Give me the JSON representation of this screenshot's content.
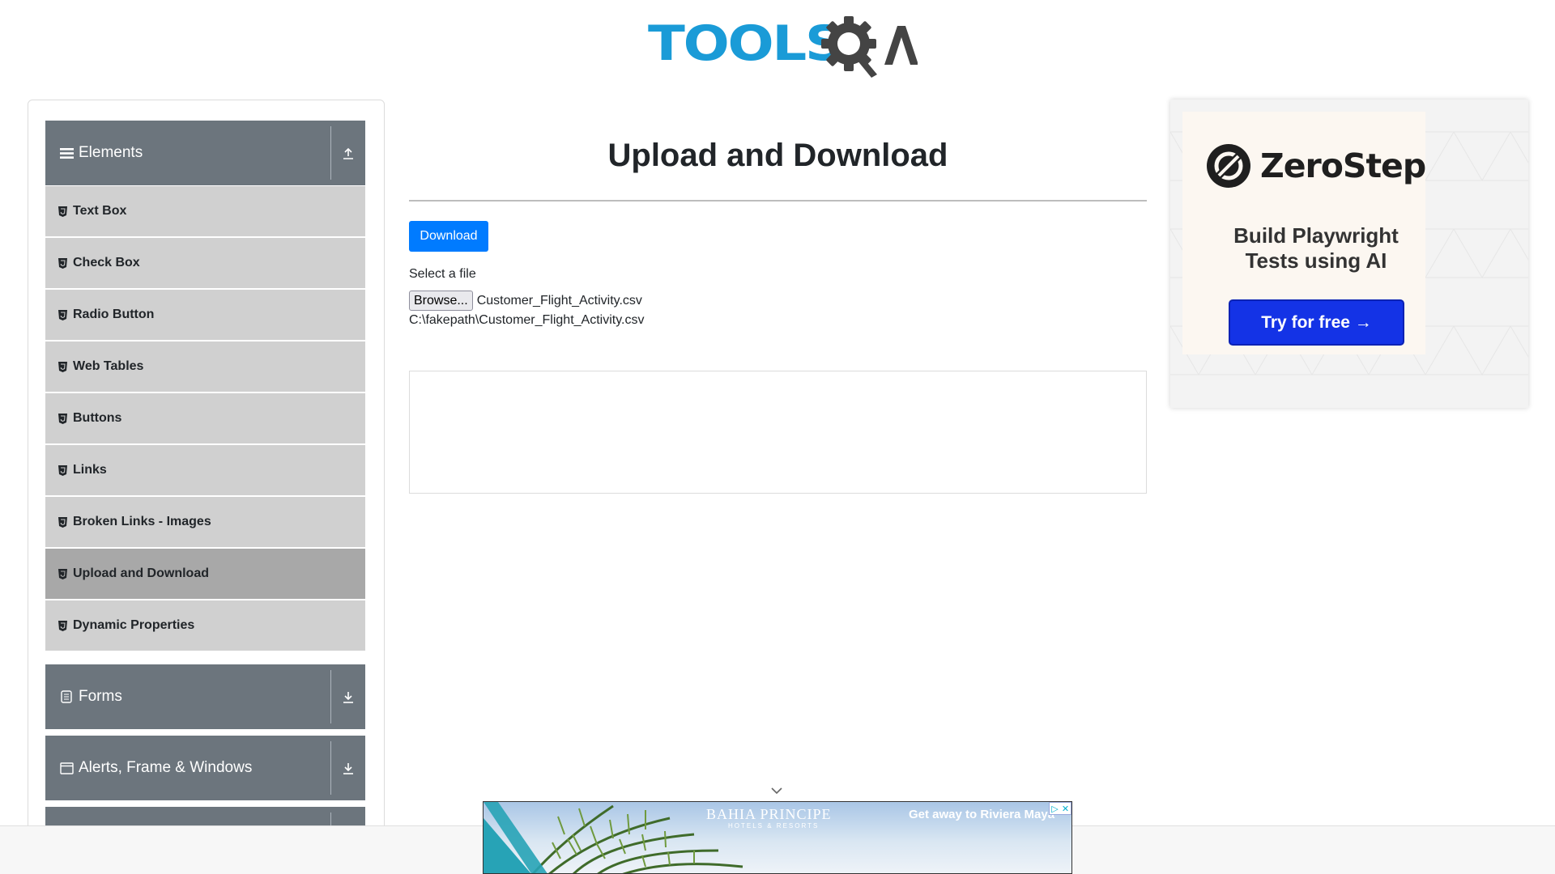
{
  "header": {
    "logo_text": "TOOLS",
    "logo_suffix": "QA",
    "logo_colors": {
      "text": "#1a9bd7",
      "gear": "#444444"
    }
  },
  "sidebar": {
    "groups": [
      {
        "label": "Elements",
        "icon": "hamburger-icon",
        "toggle_icon": "collapse-up-icon"
      },
      {
        "label": "Forms",
        "icon": "form-icon",
        "toggle_icon": "expand-down-icon"
      },
      {
        "label": "Alerts, Frame & Windows",
        "icon": "window-icon",
        "toggle_icon": "expand-down-icon"
      }
    ],
    "items": [
      {
        "label": "Text Box",
        "icon": "html5-icon"
      },
      {
        "label": "Check Box",
        "icon": "html5-icon"
      },
      {
        "label": "Radio Button",
        "icon": "html5-icon"
      },
      {
        "label": "Web Tables",
        "icon": "html5-icon"
      },
      {
        "label": "Buttons",
        "icon": "html5-icon"
      },
      {
        "label": "Links",
        "icon": "html5-icon"
      },
      {
        "label": "Broken Links - Images",
        "icon": "html5-icon"
      },
      {
        "label": "Upload and Download",
        "icon": "html5-icon",
        "active": true
      },
      {
        "label": "Dynamic Properties",
        "icon": "html5-icon"
      }
    ],
    "colors": {
      "group_bg": "#6c757d",
      "item_bg": "#d0d0d0",
      "active_bg": "#a8a8a8"
    }
  },
  "main": {
    "title": "Upload and Download",
    "download_label": "Download",
    "select_file_label": "Select a file",
    "browse_label": "Browse...",
    "file_name": "Customer_Flight_Activity.csv",
    "uploaded_path": "C:\\fakepath\\Customer_Flight_Activity.csv",
    "accent": "#007bff"
  },
  "ad_right": {
    "brand": "ZeroStep",
    "tagline_line1": "Build Playwright",
    "tagline_line2": "Tests using AI",
    "cta": "Try for free →",
    "cta_color": "#1433e6"
  },
  "ad_bottom": {
    "brand": "BAHIA PRINCIPE",
    "brand_sub": "HOTELS & RESORTS",
    "slogan": "Get away to Riviera Maya",
    "adchoices_icon": "adchoices-icon",
    "close_icon": "close-icon"
  }
}
